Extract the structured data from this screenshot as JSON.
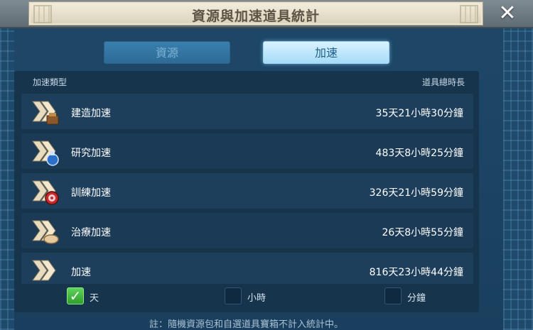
{
  "window": {
    "title": "資源與加速道具統計",
    "close_icon": "close-icon"
  },
  "tabs": [
    {
      "label": "資源",
      "active": false
    },
    {
      "label": "加速",
      "active": true
    }
  ],
  "table": {
    "col_type": "加速類型",
    "col_total": "道具總時長",
    "rows": [
      {
        "icon": "build-speedup-icon",
        "label": "建造加速",
        "value": "35天21小時30分鐘"
      },
      {
        "icon": "research-speedup-icon",
        "label": "研究加速",
        "value": "483天8小時25分鐘"
      },
      {
        "icon": "training-speedup-icon",
        "label": "訓練加速",
        "value": "326天21小時59分鐘"
      },
      {
        "icon": "healing-speedup-icon",
        "label": "治療加速",
        "value": "26天8小時55分鐘"
      },
      {
        "icon": "universal-speedup-icon",
        "label": "加速",
        "value": "816天23小時44分鐘"
      }
    ]
  },
  "units": [
    {
      "label": "天",
      "checked": true
    },
    {
      "label": "小時",
      "checked": false
    },
    {
      "label": "分鐘",
      "checked": false
    }
  ],
  "footer_note": "註：隨機資源包和自選道具寶箱不計入統計中。",
  "colors": {
    "accent": "#a6dcf7",
    "check_on": "#3fb83b",
    "background": "#1b3e5c"
  }
}
